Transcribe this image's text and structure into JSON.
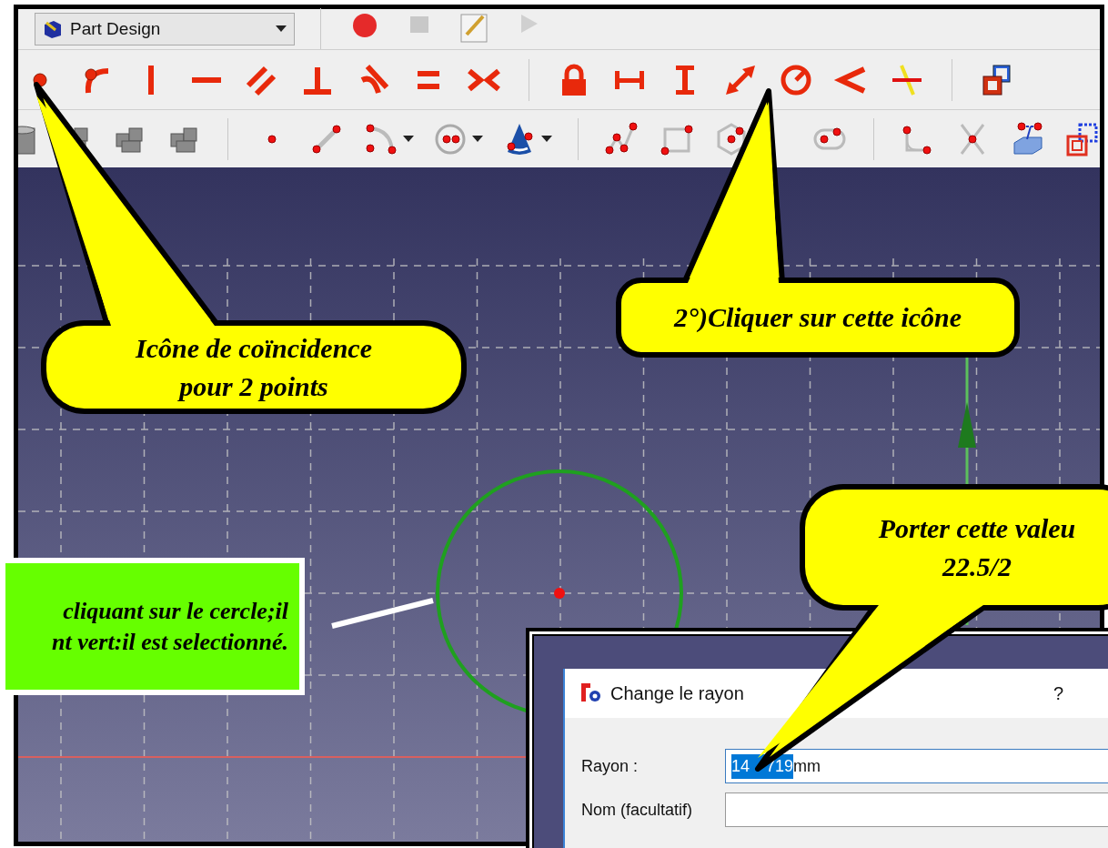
{
  "toolbar": {
    "workbench": "Part Design"
  },
  "viewport": {
    "circle": {
      "selected": true
    }
  },
  "note": {
    "lines": [
      "cliquant sur le cercle;il",
      "nt vert:il est selectionné."
    ]
  },
  "dialog": {
    "title": "Change le rayon",
    "help": "?",
    "fields": [
      {
        "label": "Rayon :",
        "value_parts": [
          "14",
          "719"
        ],
        "unit": "mm",
        "selected": true
      },
      {
        "label": "Nom (facultatif)"
      }
    ]
  },
  "callouts": [
    {
      "lines": [
        "Icône de coïncidence",
        "pour 2 points"
      ]
    },
    {
      "lines": [
        "2°)Cliquer sur cette icône"
      ]
    },
    {
      "lines": [
        "Porter cette valeu",
        "22.5/2"
      ]
    }
  ]
}
